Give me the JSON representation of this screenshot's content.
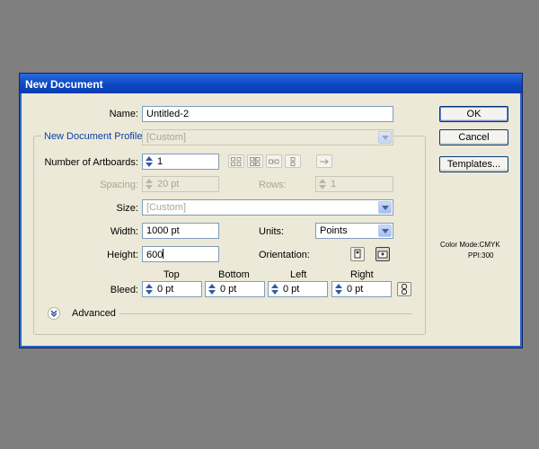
{
  "dialog": {
    "title": "New Document"
  },
  "name": {
    "label": "Name:",
    "value": "Untitled-2"
  },
  "profile": {
    "label": "New Document Profile:",
    "value": "[Custom]"
  },
  "artboards": {
    "label": "Number of Artboards:",
    "value": "1"
  },
  "spacing": {
    "label": "Spacing:",
    "value": "20 pt"
  },
  "rows": {
    "label": "Rows:",
    "value": "1"
  },
  "size": {
    "label": "Size:",
    "value": "[Custom]"
  },
  "width": {
    "label": "Width:",
    "value": "1000 pt"
  },
  "units": {
    "label": "Units:",
    "value": "Points"
  },
  "height": {
    "label": "Height:",
    "value": "600"
  },
  "orientation": {
    "label": "Orientation:",
    "selected": "landscape"
  },
  "bleed": {
    "label": "Bleed:",
    "headers": {
      "top": "Top",
      "bottom": "Bottom",
      "left": "Left",
      "right": "Right"
    },
    "top": "0 pt",
    "bottom": "0 pt",
    "left": "0 pt",
    "right": "0 pt"
  },
  "advanced": {
    "label": "Advanced"
  },
  "buttons": {
    "ok": "OK",
    "cancel": "Cancel",
    "templates": "Templates..."
  },
  "info": {
    "color_mode": "Color Mode:CMYK",
    "ppi": "PPI:300"
  },
  "colors": {
    "title_bar": "#0b47c4",
    "dialog_bg": "#ece9d8",
    "backdrop": "#7f7f7f",
    "legend_text": "#0a3ea6"
  }
}
